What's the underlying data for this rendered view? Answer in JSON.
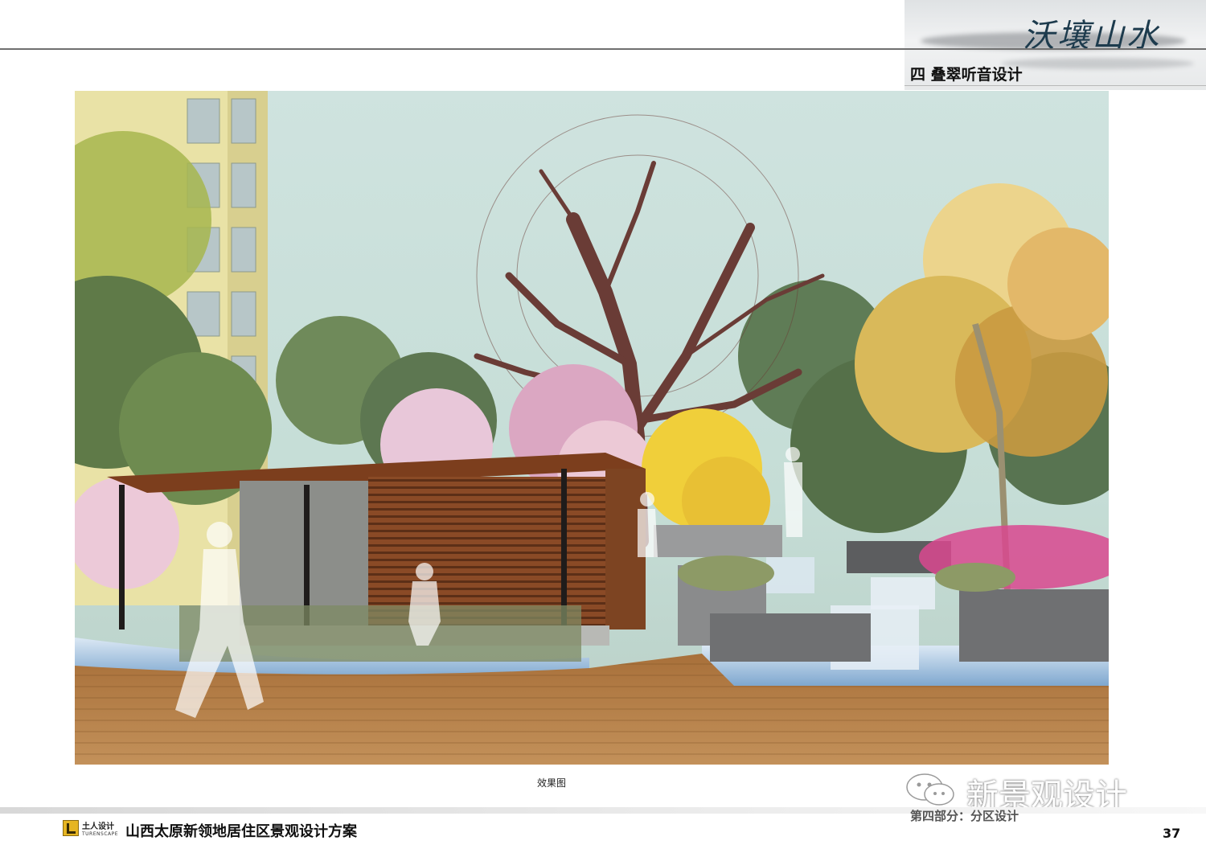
{
  "header": {
    "brand_calligraphy": "沃壤山水",
    "section_title": "四  叠翠听音设计"
  },
  "figure": {
    "caption": "效果图",
    "scene_icon": "landscape-rendering"
  },
  "footer": {
    "logo_cn": "土人设计",
    "logo_en": "TURENSCAPE",
    "project_title": "山西太原新领地居住区景观设计方案",
    "part_label": "第四部分：分区设计",
    "page_number": "37"
  },
  "watermark": {
    "text": "新景观设计",
    "icon": "wechat-icon"
  },
  "colors": {
    "accent_logo": "#e6b522",
    "title_text": "#111111",
    "calligraphy_ink": "#1d3b4d"
  }
}
